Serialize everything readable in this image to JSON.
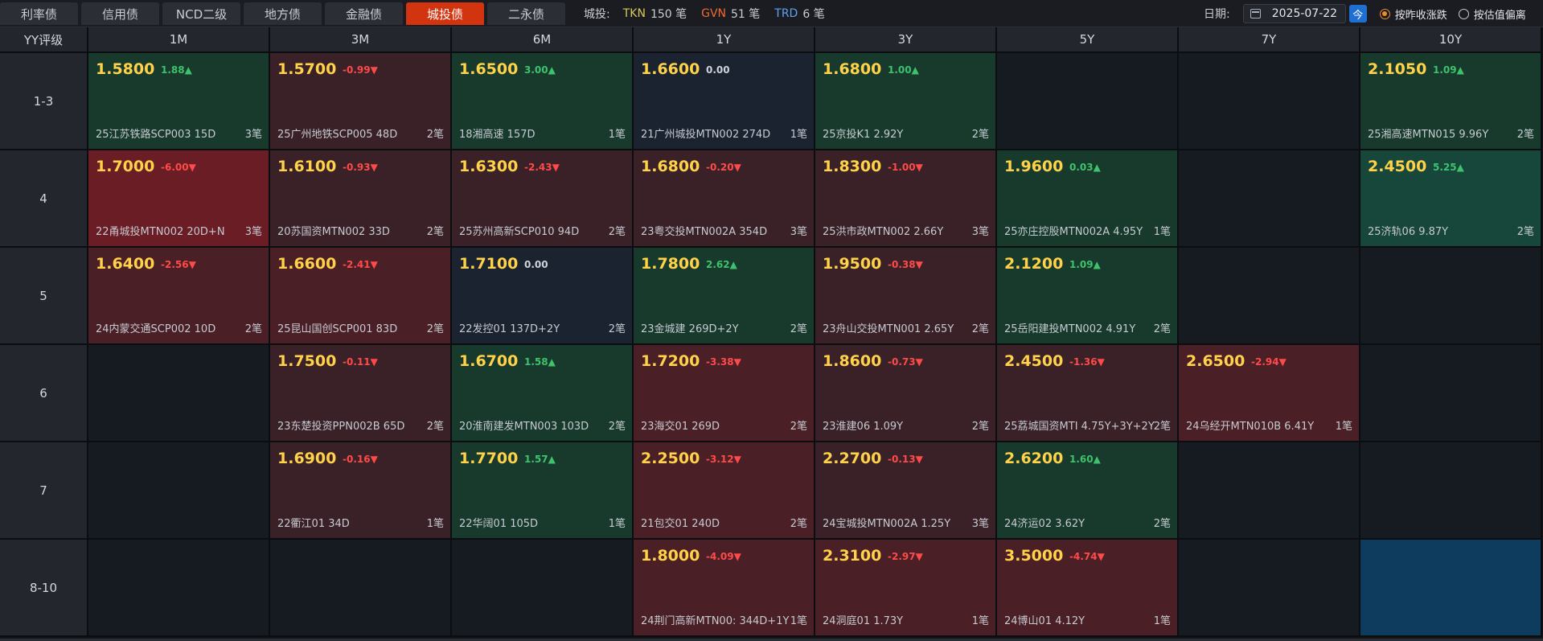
{
  "tabs": [
    {
      "label": "利率债",
      "active": false
    },
    {
      "label": "信用债",
      "active": false
    },
    {
      "label": "NCD二级",
      "active": false
    },
    {
      "label": "地方债",
      "active": false
    },
    {
      "label": "金融债",
      "active": false
    },
    {
      "label": "城投债",
      "active": true
    },
    {
      "label": "二永债",
      "active": false
    }
  ],
  "legend": {
    "label": "城投:",
    "items": [
      {
        "key": "TKN",
        "count": "150 笔",
        "color": "#d7c85a"
      },
      {
        "key": "GVN",
        "count": "51 笔",
        "color": "#f0692f"
      },
      {
        "key": "TRD",
        "count": "6 笔",
        "color": "#5ea3ef"
      }
    ]
  },
  "date": {
    "label": "日期:",
    "value": "2025-07-22",
    "today_label": "今"
  },
  "sort_options": [
    {
      "label": "按昨收涨跌",
      "checked": true
    },
    {
      "label": "按估值偏离",
      "checked": false
    }
  ],
  "grid": {
    "corner_label": "YY评级",
    "columns": [
      "1M",
      "3M",
      "6M",
      "1Y",
      "3Y",
      "5Y",
      "7Y",
      "10Y"
    ],
    "rows": [
      {
        "label": "1-3",
        "cells": [
          {
            "price": "1.5800",
            "change": "1.88",
            "dir": "up",
            "bond": "25江苏铁路SCP003 15D",
            "count": "3笔",
            "tone": "up"
          },
          {
            "price": "1.5700",
            "change": "-0.99",
            "dir": "down",
            "bond": "25广州地铁SCP005 48D",
            "count": "2笔",
            "tone": "down"
          },
          {
            "price": "1.6500",
            "change": "3.00",
            "dir": "up",
            "bond": "18湘高速 157D",
            "count": "1笔",
            "tone": "up"
          },
          {
            "price": "1.6600",
            "change": "0.00",
            "dir": "flat",
            "bond": "21广州城投MTN002 274D",
            "count": "1笔",
            "tone": "flat"
          },
          {
            "price": "1.6800",
            "change": "1.00",
            "dir": "up",
            "bond": "25京投K1 2.92Y",
            "count": "2笔",
            "tone": "up"
          },
          null,
          null,
          {
            "price": "2.1050",
            "change": "1.09",
            "dir": "up",
            "bond": "25湘高速MTN015 9.96Y",
            "count": "2笔",
            "tone": "up"
          }
        ]
      },
      {
        "label": "4",
        "cells": [
          {
            "price": "1.7000",
            "change": "-6.00",
            "dir": "down",
            "bond": "22甬城投MTN002 20D+N",
            "count": "3笔",
            "tone": "down-strong"
          },
          {
            "price": "1.6100",
            "change": "-0.93",
            "dir": "down",
            "bond": "20苏国资MTN002 33D",
            "count": "2笔",
            "tone": "down"
          },
          {
            "price": "1.6300",
            "change": "-2.43",
            "dir": "down",
            "bond": "25苏州高新SCP010 94D",
            "count": "2笔",
            "tone": "down"
          },
          {
            "price": "1.6800",
            "change": "-0.20",
            "dir": "down",
            "bond": "23粤交投MTN002A 354D",
            "count": "3笔",
            "tone": "down"
          },
          {
            "price": "1.8300",
            "change": "-1.00",
            "dir": "down",
            "bond": "25洪市政MTN002 2.66Y",
            "count": "3笔",
            "tone": "down"
          },
          {
            "price": "1.9600",
            "change": "0.03",
            "dir": "up",
            "bond": "25亦庄控股MTN002A 4.95Y",
            "count": "1笔",
            "tone": "up"
          },
          null,
          {
            "price": "2.4500",
            "change": "5.25",
            "dir": "up",
            "bond": "25济轨06 9.87Y",
            "count": "2笔",
            "tone": "up-strong"
          }
        ]
      },
      {
        "label": "5",
        "cells": [
          {
            "price": "1.6400",
            "change": "-2.56",
            "dir": "down",
            "bond": "24内蒙交通SCP002 10D",
            "count": "2笔",
            "tone": "down-mid"
          },
          {
            "price": "1.6600",
            "change": "-2.41",
            "dir": "down",
            "bond": "25昆山国创SCP001 83D",
            "count": "2笔",
            "tone": "down-mid"
          },
          {
            "price": "1.7100",
            "change": "0.00",
            "dir": "flat",
            "bond": "22发控01 137D+2Y",
            "count": "2笔",
            "tone": "flat"
          },
          {
            "price": "1.7800",
            "change": "2.62",
            "dir": "up",
            "bond": "23金城建 269D+2Y",
            "count": "2笔",
            "tone": "up"
          },
          {
            "price": "1.9500",
            "change": "-0.38",
            "dir": "down",
            "bond": "23舟山交投MTN001 2.65Y",
            "count": "2笔",
            "tone": "down"
          },
          {
            "price": "2.1200",
            "change": "1.09",
            "dir": "up",
            "bond": "25岳阳建投MTN002 4.91Y",
            "count": "2笔",
            "tone": "up"
          },
          null,
          null
        ]
      },
      {
        "label": "6",
        "cells": [
          null,
          {
            "price": "1.7500",
            "change": "-0.11",
            "dir": "down",
            "bond": "23东楚投资PPN002B 65D",
            "count": "2笔",
            "tone": "down"
          },
          {
            "price": "1.6700",
            "change": "1.58",
            "dir": "up",
            "bond": "20淮南建发MTN003 103D",
            "count": "2笔",
            "tone": "up"
          },
          {
            "price": "1.7200",
            "change": "-3.38",
            "dir": "down",
            "bond": "23海交01 269D",
            "count": "2笔",
            "tone": "down-mid"
          },
          {
            "price": "1.8600",
            "change": "-0.73",
            "dir": "down",
            "bond": "23淮建06 1.09Y",
            "count": "2笔",
            "tone": "down"
          },
          {
            "price": "2.4500",
            "change": "-1.36",
            "dir": "down",
            "bond": "25荔城国资MTI 4.75Y+3Y+2Y",
            "count": "2笔",
            "tone": "down"
          },
          {
            "price": "2.6500",
            "change": "-2.94",
            "dir": "down",
            "bond": "24乌经开MTN010B 6.41Y",
            "count": "1笔",
            "tone": "down-mid"
          },
          null
        ]
      },
      {
        "label": "7",
        "cells": [
          null,
          {
            "price": "1.6900",
            "change": "-0.16",
            "dir": "down",
            "bond": "22衢江01 34D",
            "count": "1笔",
            "tone": "down"
          },
          {
            "price": "1.7700",
            "change": "1.57",
            "dir": "up",
            "bond": "22华阔01 105D",
            "count": "1笔",
            "tone": "up"
          },
          {
            "price": "2.2500",
            "change": "-3.12",
            "dir": "down",
            "bond": "21包交01 240D",
            "count": "2笔",
            "tone": "down-mid"
          },
          {
            "price": "2.2700",
            "change": "-0.13",
            "dir": "down",
            "bond": "24宝城投MTN002A 1.25Y",
            "count": "3笔",
            "tone": "down"
          },
          {
            "price": "2.6200",
            "change": "1.60",
            "dir": "up",
            "bond": "24济运02 3.62Y",
            "count": "2笔",
            "tone": "up"
          },
          null,
          null
        ]
      },
      {
        "label": "8-10",
        "cells": [
          null,
          null,
          null,
          {
            "price": "1.8000",
            "change": "-4.09",
            "dir": "down",
            "bond": "24荆门高新MTN00: 344D+1Y",
            "count": "1笔",
            "tone": "down-mid"
          },
          {
            "price": "2.3100",
            "change": "-2.97",
            "dir": "down",
            "bond": "24洞庭01 1.73Y",
            "count": "1笔",
            "tone": "down-mid"
          },
          {
            "price": "3.5000",
            "change": "-4.74",
            "dir": "down",
            "bond": "24博山01 4.12Y",
            "count": "1笔",
            "tone": "down-mid"
          },
          null,
          {
            "selected": true
          }
        ]
      }
    ]
  }
}
